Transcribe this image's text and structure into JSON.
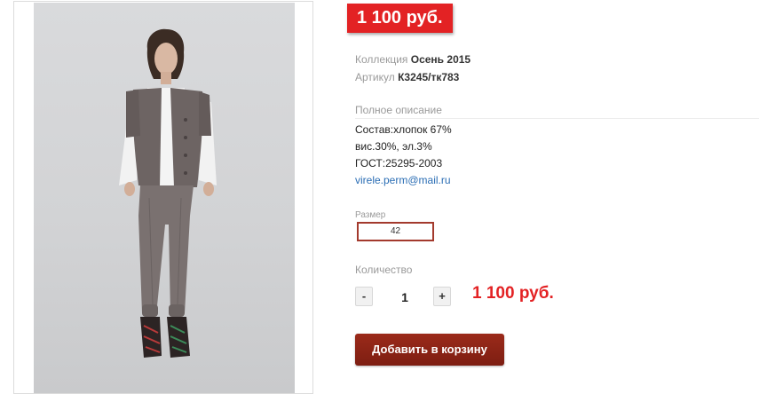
{
  "product": {
    "price_badge": "1 100 руб.",
    "collection_label": "Коллекция",
    "collection_value": "Осень 2015",
    "article_label": "Артикул",
    "article_value": "К3245/тк783",
    "description_title": "Полное описание",
    "description_lines": [
      "Состав:хлопок 67%",
      "вис.30%, эл.3%",
      "ГОСТ:25295-2003"
    ],
    "contact_email": "virele.perm@mail.ru",
    "size_label": "Размер",
    "size_value": "42",
    "quantity_label": "Количество",
    "quantity_minus": "-",
    "quantity_value": "1",
    "quantity_plus": "+",
    "total_price": "1 100 руб.",
    "add_to_cart_label": "Добавить в корзину"
  },
  "colors": {
    "price_red": "#e32224",
    "cart_button": "#8b2415",
    "size_border": "#a33a2d",
    "link_blue": "#2a6db4"
  }
}
